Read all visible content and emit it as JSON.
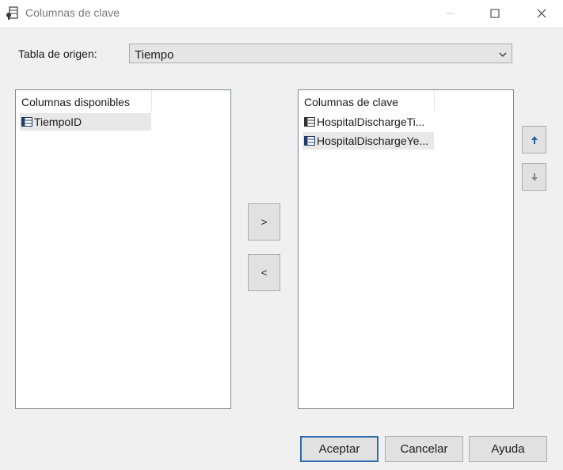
{
  "window": {
    "title": "Columnas de clave",
    "app_icon": "key-table-icon",
    "controls": [
      "minimize-icon",
      "maximize-icon",
      "close-icon"
    ]
  },
  "source_table": {
    "label": "Tabla de origen:",
    "selected": "Tiempo"
  },
  "available_columns": {
    "header": "Columnas disponibles",
    "items": [
      {
        "label": "TiempoID",
        "icon": "column-icon"
      }
    ]
  },
  "key_columns": {
    "header": "Columnas de clave",
    "items": [
      {
        "label": "HospitalDischargeTi...",
        "icon": "column-icon"
      },
      {
        "label": "HospitalDischargeYe...",
        "icon": "column-icon"
      }
    ]
  },
  "move_buttons": {
    "add": ">",
    "remove": "<"
  },
  "order_buttons": {
    "up": "arrow-up-icon",
    "down": "arrow-down-icon"
  },
  "dialog_buttons": {
    "ok": "Aceptar",
    "cancel": "Cancelar",
    "help": "Ayuda"
  },
  "colors": {
    "default_button_border": "#2b6db4",
    "arrow_up": "#1e5fa8",
    "arrow_down_disabled": "#8a8a8a"
  }
}
